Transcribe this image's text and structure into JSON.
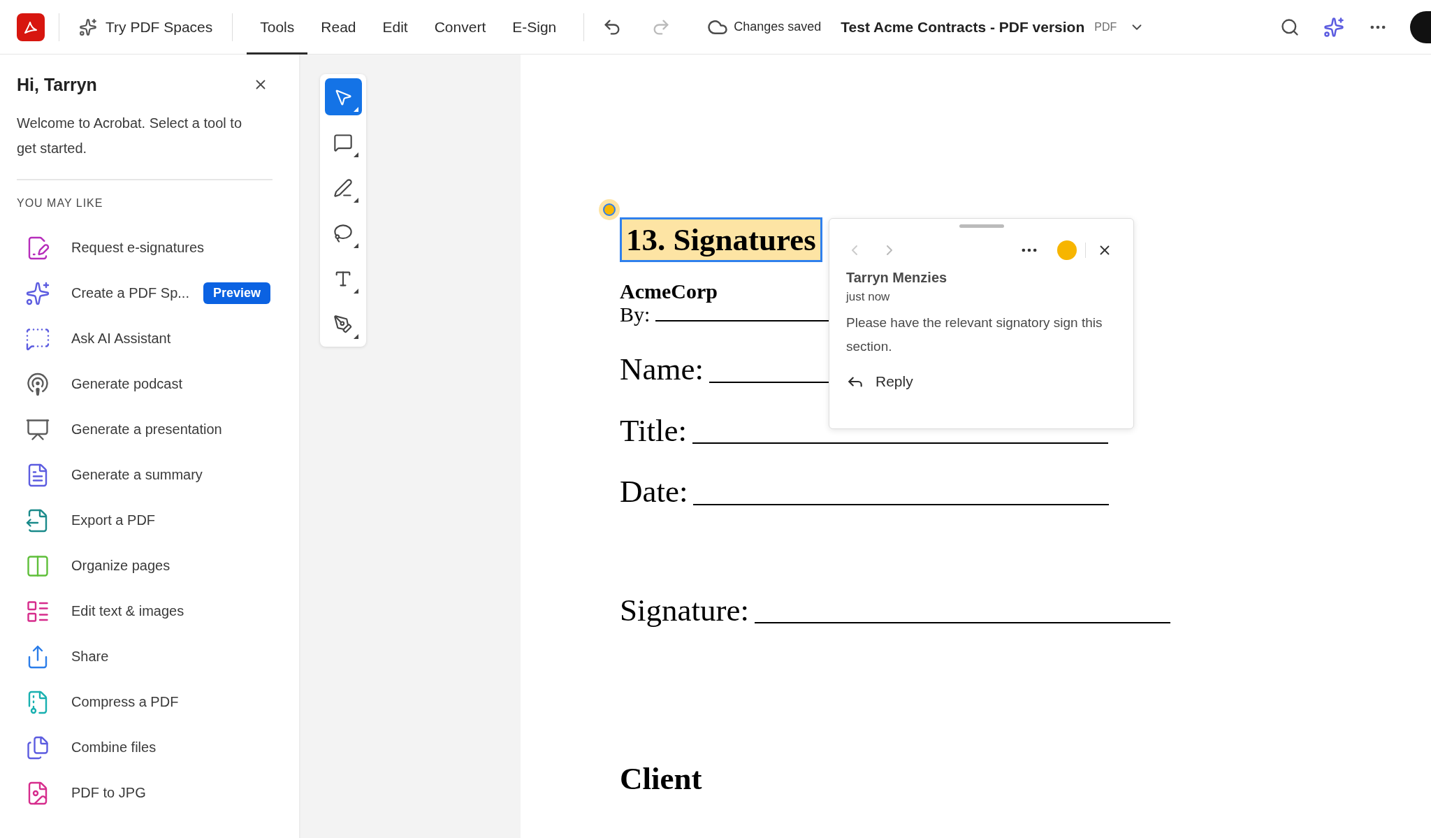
{
  "app_bar": {
    "spaces_button": "Try PDF Spaces",
    "tabs": [
      {
        "label": "Tools",
        "selected": true
      },
      {
        "label": "Read",
        "selected": false
      },
      {
        "label": "Edit",
        "selected": false
      },
      {
        "label": "Convert",
        "selected": false
      },
      {
        "label": "E-Sign",
        "selected": false
      }
    ],
    "save_status": "Changes saved",
    "document_title": "Test Acme Contracts - PDF version",
    "file_type": "PDF"
  },
  "sidebar": {
    "greeting": "Hi, Tarryn",
    "welcome": "Welcome to Acrobat. Select a tool to get started.",
    "section_title": "YOU MAY LIKE",
    "items": [
      {
        "label": "Request e-signatures",
        "kind": "esign"
      },
      {
        "label": "Create a PDF Sp...",
        "kind": "spaces",
        "badge": "Preview"
      },
      {
        "label": "Ask AI Assistant",
        "kind": "ai"
      },
      {
        "label": "Generate podcast",
        "kind": "podcast"
      },
      {
        "label": "Generate a presentation",
        "kind": "presentation"
      },
      {
        "label": "Generate a summary",
        "kind": "summary"
      },
      {
        "label": "Export a PDF",
        "kind": "export"
      },
      {
        "label": "Organize pages",
        "kind": "organize"
      },
      {
        "label": "Edit text & images",
        "kind": "edit"
      },
      {
        "label": "Share",
        "kind": "share"
      },
      {
        "label": "Compress a PDF",
        "kind": "compress"
      },
      {
        "label": "Combine files",
        "kind": "combine"
      },
      {
        "label": "PDF to JPG",
        "kind": "jpg"
      }
    ]
  },
  "tool_palette": [
    {
      "kind": "select",
      "selected": true
    },
    {
      "kind": "comment",
      "selected": false
    },
    {
      "kind": "highlight",
      "selected": false
    },
    {
      "kind": "draw",
      "selected": false
    },
    {
      "kind": "text",
      "selected": false
    },
    {
      "kind": "sign",
      "selected": false
    }
  ],
  "document": {
    "heading": "13. Signatures",
    "company": "AcmeCorp",
    "fields": [
      {
        "label": "By:",
        "kind": "small"
      },
      {
        "label": "Name:",
        "kind": "large"
      },
      {
        "label": "Title:",
        "kind": "large"
      },
      {
        "label": "Date:",
        "kind": "large"
      },
      {
        "label": "Signature:",
        "kind": "signature"
      }
    ],
    "client": "Client"
  },
  "comment": {
    "author": "Tarryn Menzies",
    "time": "just now",
    "text": "Please have the relevant signatory sign this section.",
    "color": "#f7b500",
    "reply": "Reply"
  }
}
